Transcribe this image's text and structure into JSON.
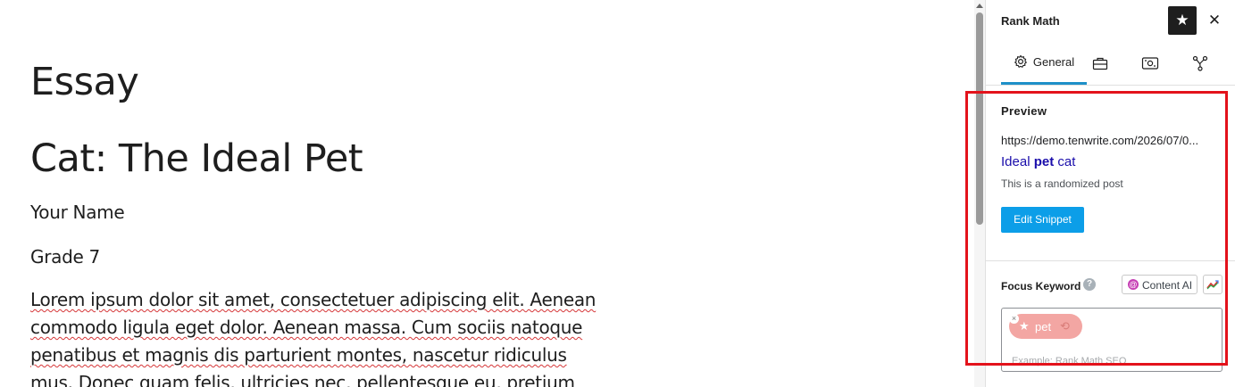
{
  "editor": {
    "heading1": "Essay",
    "heading2": "Cat: The Ideal Pet",
    "name_line": "Your Name",
    "grade_line": "Grade 7",
    "body_lines": [
      "Lorem ipsum dolor sit amet, consectetuer adipiscing elit. Aenean",
      "commodo ligula eget dolor. Aenean massa. Cum sociis natoque",
      "penatibus et magnis dis parturient montes, nascetur ridiculus",
      "mus. Donec quam felis, ultricies nec, pellentesque eu, pretium"
    ]
  },
  "sidebar": {
    "title": "Rank Math",
    "star_icon": "star-icon",
    "close_icon": "close-icon",
    "tabs": [
      {
        "label": "General",
        "icon": "gear-icon",
        "active": true
      },
      {
        "label": "",
        "icon": "toolbox-icon"
      },
      {
        "label": "",
        "icon": "schema-icon"
      },
      {
        "label": "",
        "icon": "social-share-icon"
      }
    ],
    "preview": {
      "label": "Preview",
      "url": "https://demo.tenwrite.com/2026/07/0...",
      "title_prefix": "Ideal ",
      "title_keyword": "pet",
      "title_suffix": " cat",
      "description": "This is a randomized post",
      "edit_button": "Edit Snippet"
    },
    "focus_keyword": {
      "label": "Focus Keyword",
      "help": "?",
      "content_ai_button": "Content AI",
      "keyword_tag": "pet",
      "remove_symbol": "×",
      "placeholder": "Example: Rank Math SEO"
    }
  },
  "colors": {
    "accent": "#0c9ee8",
    "tab_active": "#1e90c8",
    "link": "#1a0dab",
    "keyword_tag": "#f3a6a3",
    "highlight_frame": "#e3121b"
  }
}
